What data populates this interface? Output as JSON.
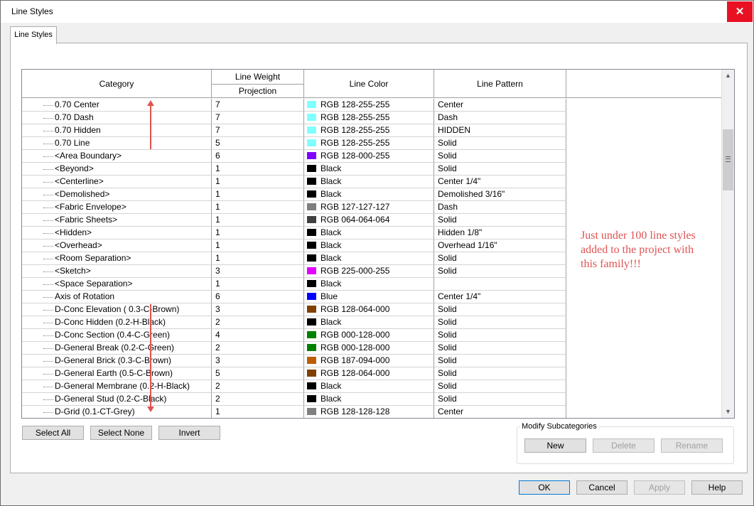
{
  "window": {
    "title": "Line Styles",
    "close_label": "✕"
  },
  "tab": {
    "label": "Line Styles"
  },
  "grid": {
    "headers": {
      "category": "Category",
      "line_weight": "Line Weight",
      "projection": "Projection",
      "line_color": "Line Color",
      "line_pattern": "Line Pattern"
    },
    "rows": [
      {
        "category": "0.70 Center",
        "weight": "7",
        "color": "RGB 128-255-255",
        "hex": "#80ffff",
        "pattern": "Center"
      },
      {
        "category": "0.70 Dash",
        "weight": "7",
        "color": "RGB 128-255-255",
        "hex": "#80ffff",
        "pattern": "Dash"
      },
      {
        "category": "0.70 Hidden",
        "weight": "7",
        "color": "RGB 128-255-255",
        "hex": "#80ffff",
        "pattern": "HIDDEN"
      },
      {
        "category": "0.70 Line",
        "weight": "5",
        "color": "RGB 128-255-255",
        "hex": "#80ffff",
        "pattern": "Solid"
      },
      {
        "category": "<Area Boundary>",
        "weight": "6",
        "color": "RGB 128-000-255",
        "hex": "#8000ff",
        "pattern": "Solid"
      },
      {
        "category": "<Beyond>",
        "weight": "1",
        "color": "Black",
        "hex": "#000000",
        "pattern": "Solid"
      },
      {
        "category": "<Centerline>",
        "weight": "1",
        "color": "Black",
        "hex": "#000000",
        "pattern": "Center 1/4\""
      },
      {
        "category": "<Demolished>",
        "weight": "1",
        "color": "Black",
        "hex": "#000000",
        "pattern": "Demolished 3/16\""
      },
      {
        "category": "<Fabric Envelope>",
        "weight": "1",
        "color": "RGB 127-127-127",
        "hex": "#7f7f7f",
        "pattern": "Dash"
      },
      {
        "category": "<Fabric Sheets>",
        "weight": "1",
        "color": "RGB 064-064-064",
        "hex": "#404040",
        "pattern": "Solid"
      },
      {
        "category": "<Hidden>",
        "weight": "1",
        "color": "Black",
        "hex": "#000000",
        "pattern": "Hidden 1/8\""
      },
      {
        "category": "<Overhead>",
        "weight": "1",
        "color": "Black",
        "hex": "#000000",
        "pattern": "Overhead 1/16\""
      },
      {
        "category": "<Room Separation>",
        "weight": "1",
        "color": "Black",
        "hex": "#000000",
        "pattern": "Solid"
      },
      {
        "category": "<Sketch>",
        "weight": "3",
        "color": "RGB 225-000-255",
        "hex": "#e100ff",
        "pattern": "Solid"
      },
      {
        "category": "<Space Separation>",
        "weight": "1",
        "color": "Black",
        "hex": "#000000",
        "pattern": ""
      },
      {
        "category": "Axis of Rotation",
        "weight": "6",
        "color": "Blue",
        "hex": "#0000ff",
        "pattern": "Center 1/4\""
      },
      {
        "category": "D-Conc Elevation ( 0.3-C-Brown)",
        "weight": "3",
        "color": "RGB 128-064-000",
        "hex": "#804000",
        "pattern": "Solid"
      },
      {
        "category": "D-Conc Hidden (0.2-H-Black)",
        "weight": "2",
        "color": "Black",
        "hex": "#000000",
        "pattern": "Solid"
      },
      {
        "category": "D-Conc Section (0.4-C-Green)",
        "weight": "4",
        "color": "RGB 000-128-000",
        "hex": "#008000",
        "pattern": "Solid"
      },
      {
        "category": "D-General Break (0.2-C-Green)",
        "weight": "2",
        "color": "RGB 000-128-000",
        "hex": "#008000",
        "pattern": "Solid"
      },
      {
        "category": "D-General Brick (0.3-C-Brown)",
        "weight": "3",
        "color": "RGB 187-094-000",
        "hex": "#bb5e00",
        "pattern": "Solid"
      },
      {
        "category": "D-General Earth (0.5-C-Brown)",
        "weight": "5",
        "color": "RGB 128-064-000",
        "hex": "#804000",
        "pattern": "Solid"
      },
      {
        "category": "D-General Membrane (0.2-H-Black)",
        "weight": "2",
        "color": "Black",
        "hex": "#000000",
        "pattern": "Solid"
      },
      {
        "category": "D-General Stud (0.2-C-Black)",
        "weight": "2",
        "color": "Black",
        "hex": "#000000",
        "pattern": "Solid"
      },
      {
        "category": "D-Grid (0.1-CT-Grey)",
        "weight": "1",
        "color": "RGB 128-128-128",
        "hex": "#808080",
        "pattern": "Center"
      }
    ]
  },
  "annotation": {
    "text": "Just under 100 line styles added to the project with this family!!!"
  },
  "selection_buttons": {
    "select_all": "Select All",
    "select_none": "Select None",
    "invert": "Invert"
  },
  "modify_subcategories": {
    "label": "Modify Subcategories",
    "new": "New",
    "delete": "Delete",
    "rename": "Rename"
  },
  "footer": {
    "ok": "OK",
    "cancel": "Cancel",
    "apply": "Apply",
    "help": "Help"
  },
  "colors": {
    "annotation": "#e05252",
    "close_button": "#e81123"
  }
}
